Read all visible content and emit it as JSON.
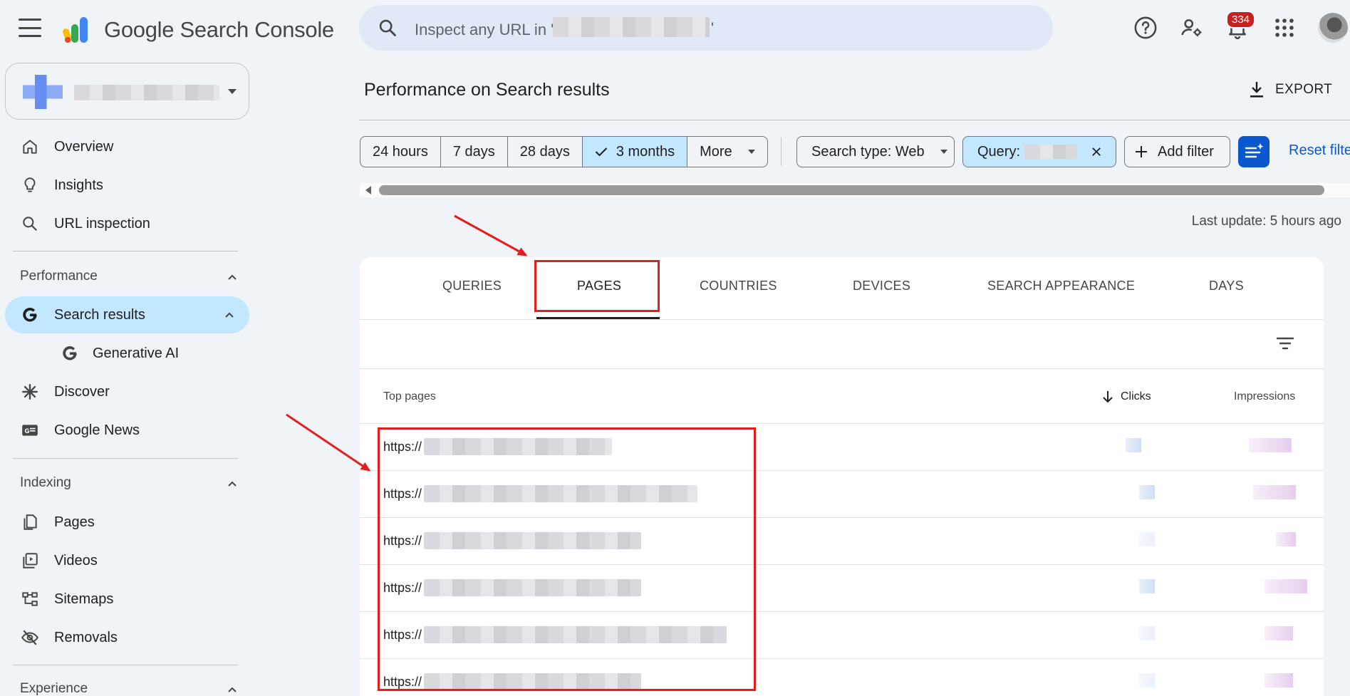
{
  "app": {
    "title": "Google Search Console",
    "search_prefix": "Inspect any URL in '",
    "search_suffix": "'",
    "notification_count": "334"
  },
  "sidebar": {
    "items": [
      {
        "label": "Overview",
        "icon": "home-icon"
      },
      {
        "label": "Insights",
        "icon": "lightbulb-icon"
      },
      {
        "label": "URL inspection",
        "icon": "search-icon"
      }
    ],
    "performance": {
      "heading": "Performance",
      "items": [
        {
          "label": "Search results",
          "icon": "google-g-icon",
          "active": true
        },
        {
          "label": "Generative AI",
          "icon": "google-g-icon"
        },
        {
          "label": "Discover",
          "icon": "asterisk-icon"
        },
        {
          "label": "Google News",
          "icon": "news-icon"
        }
      ]
    },
    "indexing": {
      "heading": "Indexing",
      "items": [
        {
          "label": "Pages",
          "icon": "pages-icon"
        },
        {
          "label": "Videos",
          "icon": "videos-icon"
        },
        {
          "label": "Sitemaps",
          "icon": "sitemap-icon"
        },
        {
          "label": "Removals",
          "icon": "eye-off-icon"
        }
      ]
    },
    "experience": {
      "heading": "Experience"
    }
  },
  "main": {
    "title": "Performance on Search results",
    "export_label": "EXPORT",
    "date_ranges": [
      "24 hours",
      "7 days",
      "28 days",
      "3 months",
      "More"
    ],
    "selected_range": "3 months",
    "search_type_label": "Search type: Web",
    "query_label": "Query:",
    "add_filter_label": "Add filter",
    "reset_label": "Reset filte",
    "last_update": "Last update: 5 hours ago",
    "tabs": [
      "QUERIES",
      "PAGES",
      "COUNTRIES",
      "DEVICES",
      "SEARCH APPEARANCE",
      "DAYS"
    ],
    "active_tab": "PAGES",
    "table": {
      "columns": [
        "Top pages",
        "Clicks",
        "Impressions"
      ],
      "rows": [
        {
          "url": "https://"
        },
        {
          "url": "https://"
        },
        {
          "url": "https://"
        },
        {
          "url": "https://"
        },
        {
          "url": "https://"
        },
        {
          "url": "https://"
        }
      ]
    }
  },
  "colors": {
    "background": "#f0f4f9",
    "accent_blue": "#0b57d0",
    "selected_chip": "#c2e7ff",
    "annotation_red": "#e21f1f"
  }
}
